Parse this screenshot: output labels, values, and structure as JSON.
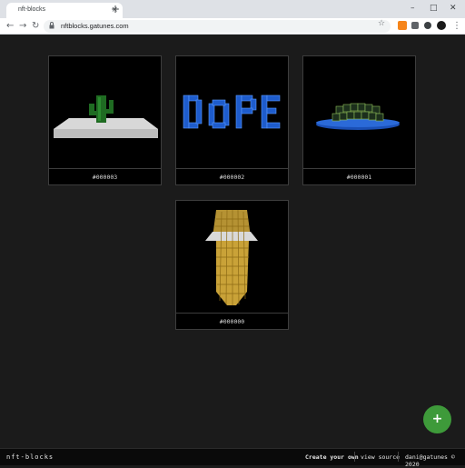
{
  "browser": {
    "tab_title": "nft-blocks",
    "tab_close": "×",
    "new_tab": "+",
    "url": "nftblocks.gatunes.com",
    "controls": {
      "minimize": "–",
      "maximize": "□",
      "close": "✕"
    },
    "nav": {
      "back": "←",
      "forward": "→",
      "reload": "↻"
    },
    "star": "☆",
    "menu": "⋮"
  },
  "cards": [
    {
      "id": "#000003",
      "art": "cactus-voxel"
    },
    {
      "id": "#000002",
      "art": "dope-voxel-text"
    },
    {
      "id": "#000001",
      "art": "island-voxel"
    },
    {
      "id": "#000000",
      "art": "corn-voxel"
    }
  ],
  "fab": {
    "label": "+"
  },
  "footer": {
    "brand": "nft-blocks",
    "create": "Create your own",
    "source": "view source",
    "credit": "dani@gatunes © 2020"
  },
  "colors": {
    "page_bg": "#1b1b1b",
    "fab": "#3e9a3a",
    "cactus": "#1f6b22",
    "dope_blue": "#1e5ccc",
    "corn": "#c9a238"
  }
}
